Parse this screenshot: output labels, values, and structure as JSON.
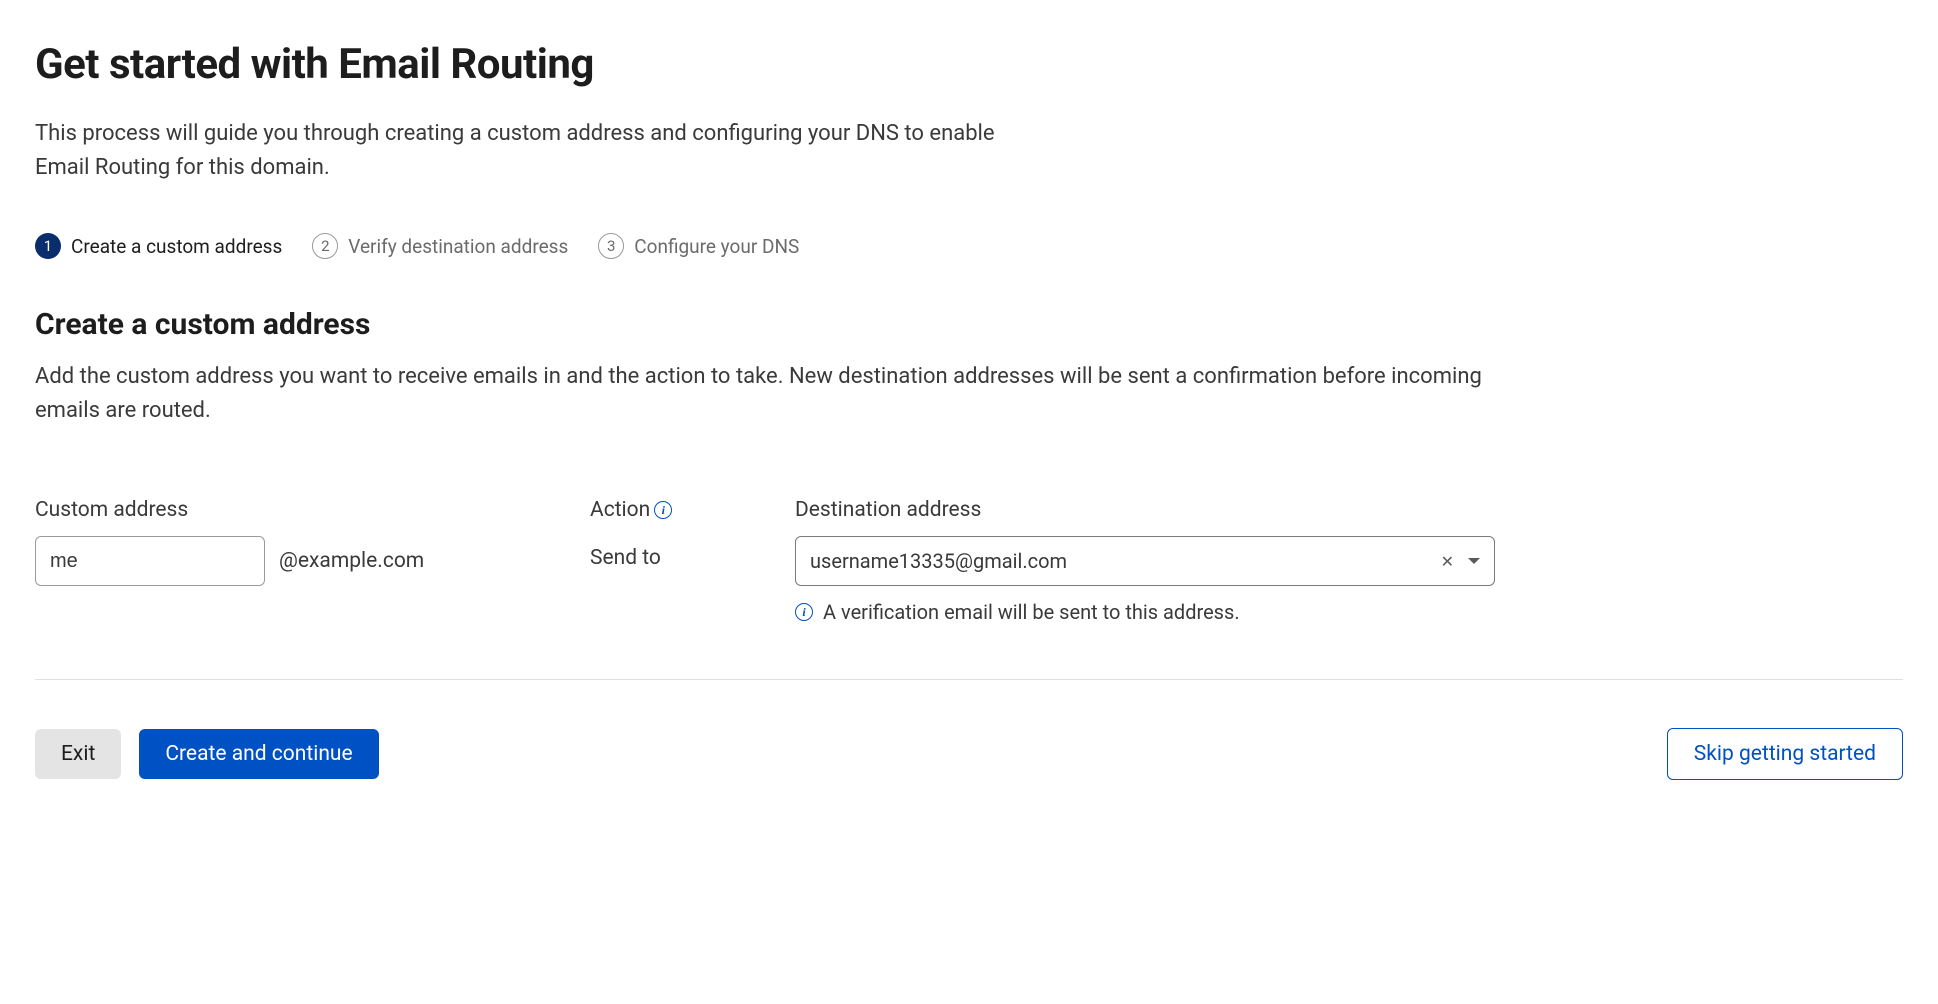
{
  "page": {
    "title": "Get started with Email Routing",
    "description": "This process will guide you through creating a custom address and configuring your DNS to enable Email Routing for this domain."
  },
  "steps": [
    {
      "number": "1",
      "label": "Create a custom address",
      "active": true
    },
    {
      "number": "2",
      "label": "Verify destination address",
      "active": false
    },
    {
      "number": "3",
      "label": "Configure your DNS",
      "active": false
    }
  ],
  "section": {
    "title": "Create a custom address",
    "description": "Add the custom address you want to receive emails in and the action to take. New destination addresses will be sent a confirmation before incoming emails are routed."
  },
  "form": {
    "custom_address": {
      "label": "Custom address",
      "value": "me",
      "domain": "@example.com"
    },
    "action": {
      "label": "Action",
      "value": "Send to"
    },
    "destination": {
      "label": "Destination address",
      "value": "username13335@gmail.com",
      "note": "A verification email will be sent to this address."
    }
  },
  "buttons": {
    "exit": "Exit",
    "continue": "Create and continue",
    "skip": "Skip getting started"
  }
}
